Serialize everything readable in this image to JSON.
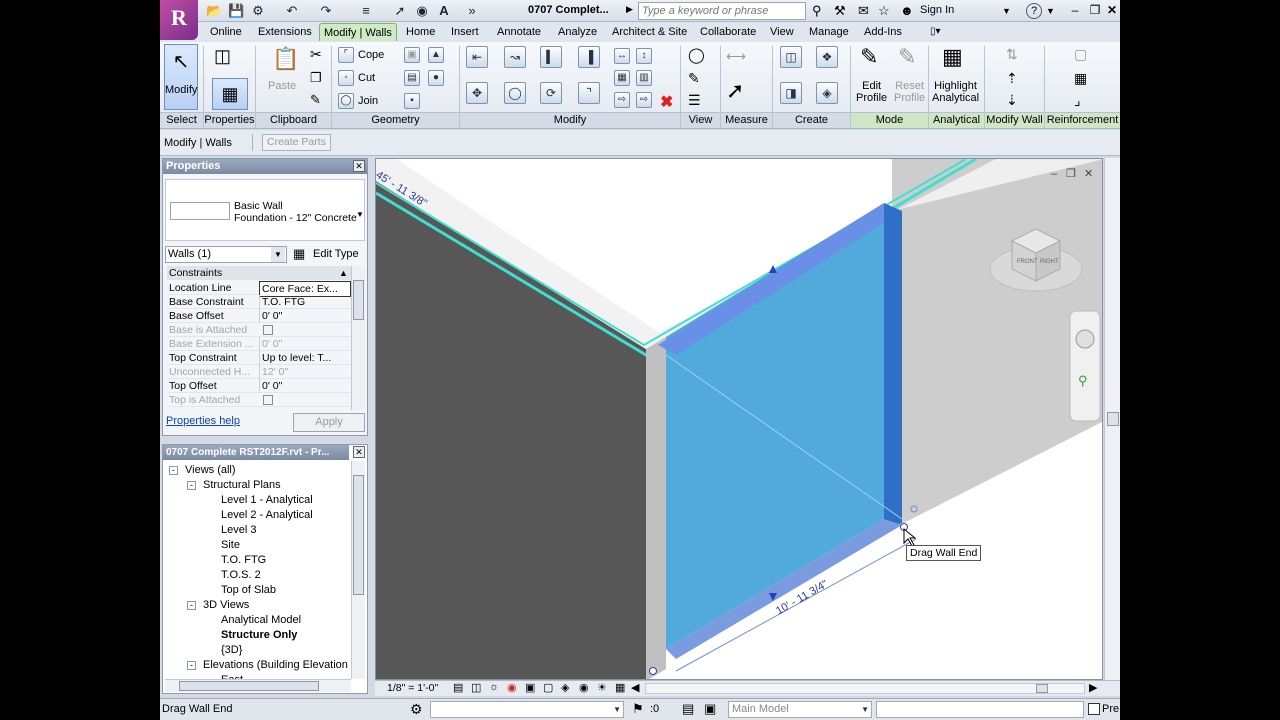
{
  "app": {
    "logo": "R",
    "doc_title": "0707 Complet...",
    "search_placeholder": "Type a keyword or phrase",
    "sign_in": "Sign In"
  },
  "tabs": [
    "Online",
    "Extensions",
    "Modify | Walls",
    "Home",
    "Insert",
    "Annotate",
    "Analyze",
    "Architect & Site",
    "Collaborate",
    "View",
    "Manage",
    "Add-Ins"
  ],
  "ribbon": {
    "modify_label": "Modify",
    "clipboard": {
      "paste": "Paste"
    },
    "geometry": {
      "cope": "Cope",
      "cut": "Cut",
      "join": "Join"
    },
    "mode": {
      "edit_profile": [
        "Edit",
        "Profile"
      ],
      "reset_profile": [
        "Reset",
        "Profile"
      ]
    },
    "analytical": {
      "highlight": [
        "Highlight",
        "Analytical"
      ]
    },
    "panels": [
      "Select",
      "Properties",
      "Clipboard",
      "Geometry",
      "Modify",
      "View",
      "Measure",
      "Create",
      "Mode",
      "Analytical",
      "Modify Wall",
      "Reinforcement"
    ]
  },
  "options_bar": {
    "context": "Modify | Walls",
    "create_parts": "Create Parts"
  },
  "properties": {
    "title": "Properties",
    "type_family": "Basic Wall",
    "type_name": "Foundation - 12\" Concrete",
    "selector": "Walls (1)",
    "edit_type": "Edit Type",
    "group": "Constraints",
    "rows": [
      {
        "name": "Location Line",
        "value": "Core Face: Ex..."
      },
      {
        "name": "Base Constraint",
        "value": "T.O. FTG"
      },
      {
        "name": "Base Offset",
        "value": "0'  0\""
      },
      {
        "name": "Base is Attached",
        "value": ""
      },
      {
        "name": "Base Extension ...",
        "value": "0'  0\""
      },
      {
        "name": "Top Constraint",
        "value": "Up to level: T..."
      },
      {
        "name": "Unconnected H...",
        "value": "12'  0\""
      },
      {
        "name": "Top Offset",
        "value": "0'  0\""
      },
      {
        "name": "Top is Attached",
        "value": ""
      }
    ],
    "help": "Properties help",
    "apply": "Apply"
  },
  "browser": {
    "title": "0707 Complete RST2012F.rvt - Pr...",
    "items": [
      {
        "label": "Views (all)",
        "level": 0,
        "box": "-"
      },
      {
        "label": "Structural Plans",
        "level": 1,
        "box": "-"
      },
      {
        "label": "Level 1 - Analytical",
        "level": 2
      },
      {
        "label": "Level 2 - Analytical",
        "level": 2
      },
      {
        "label": "Level 3",
        "level": 2
      },
      {
        "label": "Site",
        "level": 2
      },
      {
        "label": "T.O. FTG",
        "level": 2
      },
      {
        "label": "T.O.S. 2",
        "level": 2
      },
      {
        "label": "Top of Slab",
        "level": 2
      },
      {
        "label": "3D Views",
        "level": 1,
        "box": "-"
      },
      {
        "label": "Analytical Model",
        "level": 2
      },
      {
        "label": "Structure Only",
        "level": 2,
        "bold": true
      },
      {
        "label": "{3D}",
        "level": 2
      },
      {
        "label": "Elevations (Building Elevation",
        "level": 1,
        "box": "-"
      },
      {
        "label": "East",
        "level": 2
      }
    ]
  },
  "viewport": {
    "dim_top": "45' - 11 3/8\"",
    "dim_bottom": "10' - 11 3/4\"",
    "tooltip": "Drag Wall End",
    "viewcube": {
      "front": "FRONT",
      "right": "RIGHT"
    },
    "colors": {
      "selected": "#3fa0d8",
      "wall_dark": "#555555",
      "wall_light": "#c8c8c8",
      "edge": "#3de0d0"
    }
  },
  "view_bar": {
    "scale": "1/8\" = 1'-0\""
  },
  "status": {
    "message": "Drag Wall End",
    "coord": ":0",
    "model": "Main Model",
    "press_drag": "Pre"
  }
}
